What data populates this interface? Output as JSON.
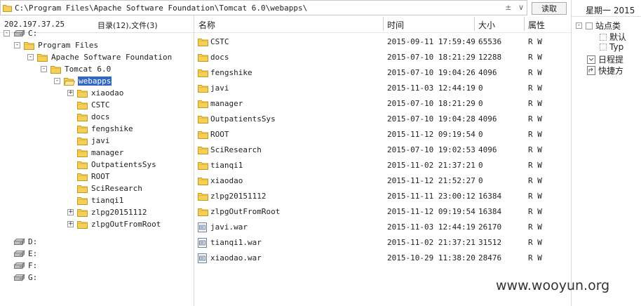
{
  "path_bar": {
    "path": "C:\\Program Files\\Apache Software Foundation\\Tomcat 6.0\\webapps\\",
    "btn_plus": "±",
    "btn_down": "∨"
  },
  "read_button": "读取",
  "left_header": {
    "ip": "202.197.37.25",
    "counts": "目录(12),文件(3)"
  },
  "tree": [
    {
      "label": "C:",
      "exp": "-",
      "icon": "drive"
    },
    {
      "label": "Program Files",
      "exp": "-",
      "icon": "folder"
    },
    {
      "label": "Apache Software Foundation",
      "exp": "-",
      "icon": "folder"
    },
    {
      "label": "Tomcat 6.0",
      "exp": "-",
      "icon": "folder"
    },
    {
      "label": "webapps",
      "exp": "-",
      "icon": "folder-open",
      "selected": true
    },
    {
      "label": "xiaodao",
      "exp": "+",
      "icon": "folder"
    },
    {
      "label": "CSTC",
      "exp": "",
      "icon": "folder"
    },
    {
      "label": "docs",
      "exp": "",
      "icon": "folder"
    },
    {
      "label": "fengshike",
      "exp": "",
      "icon": "folder"
    },
    {
      "label": "javi",
      "exp": "",
      "icon": "folder"
    },
    {
      "label": "manager",
      "exp": "",
      "icon": "folder"
    },
    {
      "label": "OutpatientsSys",
      "exp": "",
      "icon": "folder"
    },
    {
      "label": "ROOT",
      "exp": "",
      "icon": "folder"
    },
    {
      "label": "SciResearch",
      "exp": "",
      "icon": "folder"
    },
    {
      "label": "tianqi1",
      "exp": "",
      "icon": "folder"
    },
    {
      "label": "zlpg20151112",
      "exp": "+",
      "icon": "folder"
    },
    {
      "label": "zlpgOutFromRoot",
      "exp": "+",
      "icon": "folder"
    }
  ],
  "drives": [
    "D:",
    "E:",
    "F:",
    "G:"
  ],
  "columns": {
    "name": "名称",
    "time": "时间",
    "size": "大小",
    "attr": "属性"
  },
  "files": [
    {
      "name": "CSTC",
      "time": "2015-09-11 17:59:49",
      "size": "65536",
      "attr": "R W",
      "type": "folder"
    },
    {
      "name": "docs",
      "time": "2015-07-10 18:21:29",
      "size": "12288",
      "attr": "R W",
      "type": "folder"
    },
    {
      "name": "fengshike",
      "time": "2015-07-10 19:04:26",
      "size": "4096",
      "attr": "R W",
      "type": "folder"
    },
    {
      "name": "javi",
      "time": "2015-11-03 12:44:19",
      "size": "0",
      "attr": "R W",
      "type": "folder"
    },
    {
      "name": "manager",
      "time": "2015-07-10 18:21:29",
      "size": "0",
      "attr": "R W",
      "type": "folder"
    },
    {
      "name": "OutpatientsSys",
      "time": "2015-07-10 19:04:28",
      "size": "4096",
      "attr": "R W",
      "type": "folder"
    },
    {
      "name": "ROOT",
      "time": "2015-11-12 09:19:54",
      "size": "0",
      "attr": "R W",
      "type": "folder"
    },
    {
      "name": "SciResearch",
      "time": "2015-07-10 19:02:53",
      "size": "4096",
      "attr": "R W",
      "type": "folder"
    },
    {
      "name": "tianqi1",
      "time": "2015-11-02 21:37:21",
      "size": "0",
      "attr": "R W",
      "type": "folder"
    },
    {
      "name": "xiaodao",
      "time": "2015-11-12 21:52:27",
      "size": "0",
      "attr": "R W",
      "type": "folder"
    },
    {
      "name": "zlpg20151112",
      "time": "2015-11-11 23:00:12",
      "size": "16384",
      "attr": "R W",
      "type": "folder"
    },
    {
      "name": "zlpgOutFromRoot",
      "time": "2015-11-12 09:19:54",
      "size": "16384",
      "attr": "R W",
      "type": "folder"
    },
    {
      "name": "javi.war",
      "time": "2015-11-03 12:44:19",
      "size": "26170",
      "attr": "R W",
      "type": "file"
    },
    {
      "name": "tianqi1.war",
      "time": "2015-11-02 21:37:21",
      "size": "31512",
      "attr": "R W",
      "type": "file"
    },
    {
      "name": "xiaodao.war",
      "time": "2015-10-29 11:38:20",
      "size": "28476",
      "attr": "R W",
      "type": "file"
    }
  ],
  "right_panel": {
    "date": "星期一 2015",
    "items": [
      {
        "label": "站点类",
        "exp": "-"
      },
      {
        "label": "默认",
        "cb": true
      },
      {
        "label": "Typ",
        "cb": true
      },
      {
        "label": "日程提",
        "icon": "schedule"
      },
      {
        "label": "快捷方",
        "icon": "shortcut"
      }
    ]
  },
  "watermark": "www.wooyun.org",
  "colors": {
    "folder": "#f4cf5a",
    "folder_edge": "#c49a1e",
    "selection": "#3168c6",
    "file_icon": "#6b7f9e"
  }
}
